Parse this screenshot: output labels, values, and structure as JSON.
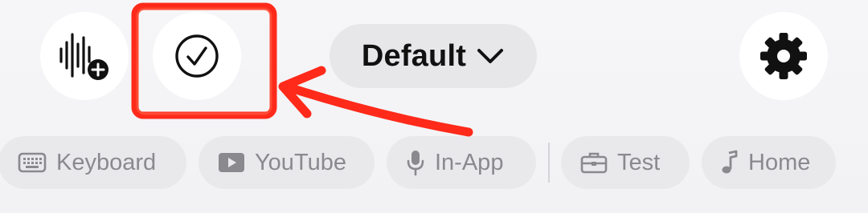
{
  "toolbar": {
    "profile_label": "Default"
  },
  "chips": [
    {
      "label": "Keyboard",
      "icon": "keyboard-icon"
    },
    {
      "label": "YouTube",
      "icon": "play-icon"
    },
    {
      "label": "In-App",
      "icon": "microphone-icon"
    },
    {
      "label": "Test",
      "icon": "briefcase-icon"
    },
    {
      "label": "Home",
      "icon": "music-note-icon"
    }
  ],
  "colors": {
    "background": "#f3f3f5",
    "chip_bg": "#e9e9ec",
    "chip_text": "#8a8a8e",
    "annotation_red": "#ff2a1a"
  }
}
